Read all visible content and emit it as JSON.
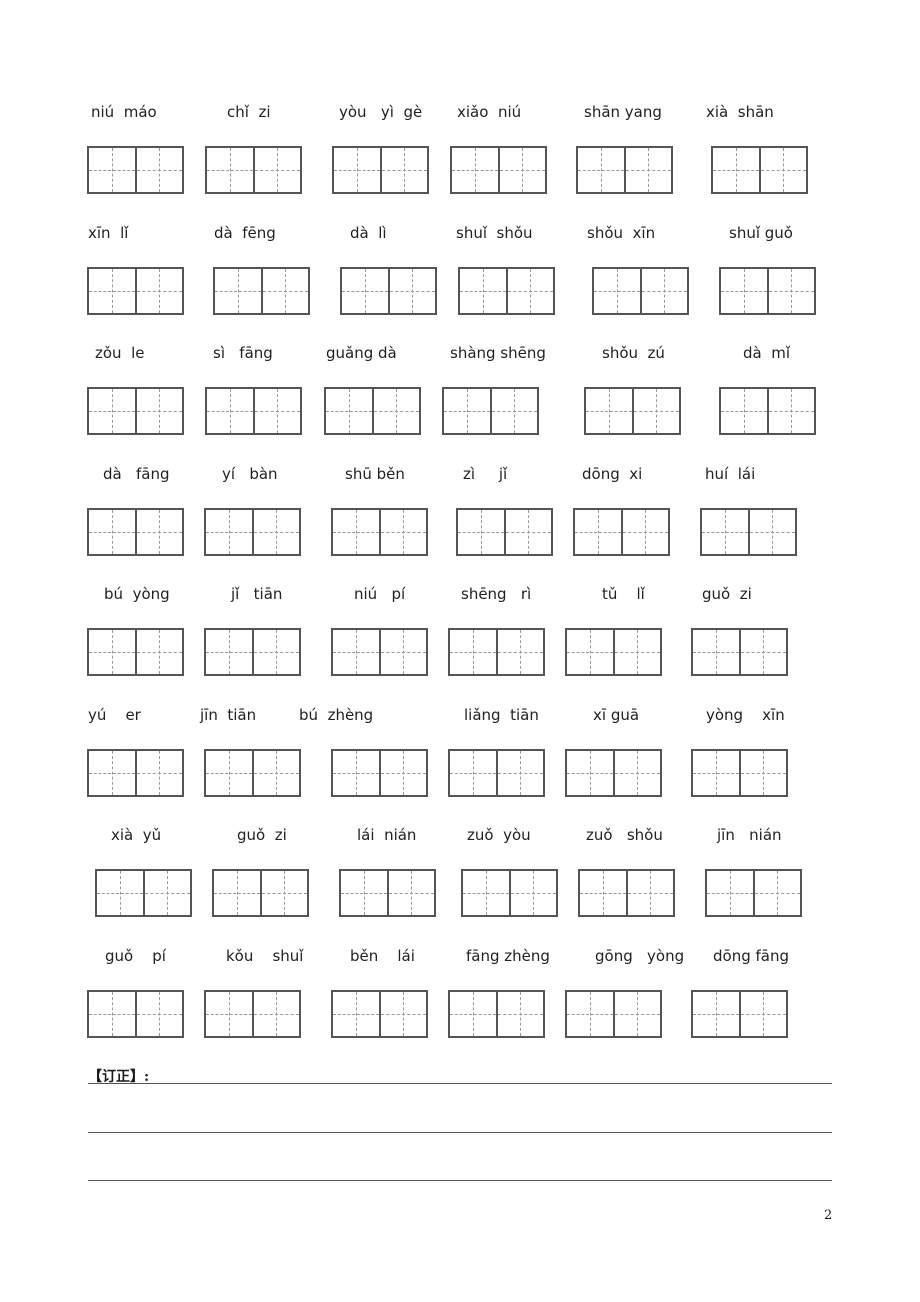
{
  "rows": [
    [
      "niú  máo",
      "chǐ  zi",
      "yòu   yì  gè",
      "xiǎo  niú",
      "shān yang",
      "xià  shān"
    ],
    [
      "xīn  lǐ",
      "dà  fēng",
      "dà  lì",
      "shuǐ  shǒu",
      "shǒu  xīn",
      "shuǐ guǒ"
    ],
    [
      "zǒu  le",
      "sì   fāng",
      "guǎng dà",
      "shàng shēng",
      "shǒu  zú",
      "dà  mǐ"
    ],
    [
      "dà   fāng",
      "yí   bàn",
      "shū běn",
      "zì     jǐ",
      "dōng  xi",
      "huí  lái"
    ],
    [
      "bú  yòng",
      "jǐ   tiān",
      "niú   pí",
      "shēng   rì",
      "tǔ    lǐ",
      "guǒ  zi"
    ],
    [
      "yú    er",
      "jīn  tiān",
      "bú  zhèng",
      "liǎng  tiān",
      "xī guā",
      "yòng    xīn"
    ],
    [
      "xià  yǔ",
      "guǒ  zi",
      "lái  nián",
      "zuǒ  yòu",
      "zuǒ   shǒu",
      "jīn   nián"
    ],
    [
      "guǒ    pí",
      "kǒu    shuǐ",
      "běn    lái",
      "fāng zhèng",
      "gōng   yòng",
      "dōng fāng"
    ]
  ],
  "correction_label": "【订正】:",
  "page_number": "2"
}
